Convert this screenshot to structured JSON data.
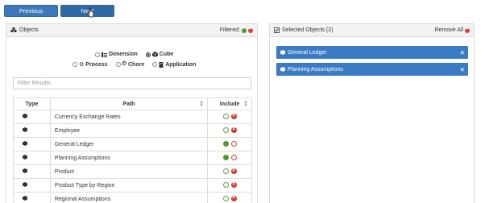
{
  "nav": {
    "previous_label": "Previous",
    "next_label": "Next"
  },
  "left_panel": {
    "title": "Objects",
    "filtered_label": "Filtered:",
    "types_row1": [
      {
        "label": "Dimension",
        "selected": false
      },
      {
        "label": "Cube",
        "selected": true
      }
    ],
    "types_row2": [
      {
        "label": "Process",
        "selected": false
      },
      {
        "label": "Chore",
        "selected": false
      },
      {
        "label": "Application",
        "selected": false
      }
    ],
    "filter_placeholder": "Filter Results",
    "table": {
      "headers": {
        "type": "Type",
        "path": "Path",
        "include": "Include"
      },
      "rows": [
        {
          "path": "Currency Exchange Rates",
          "include": "excluded"
        },
        {
          "path": "Employee",
          "include": "excluded"
        },
        {
          "path": "General Ledger",
          "include": "included"
        },
        {
          "path": "Planning Assumptions",
          "include": "included"
        },
        {
          "path": "Product",
          "include": "excluded"
        },
        {
          "path": "Product Type by Region",
          "include": "excluded"
        },
        {
          "path": "Regional Assumptions",
          "include": "excluded"
        }
      ]
    }
  },
  "right_panel": {
    "title": "Selected Objects (2)",
    "remove_all_label": "Remove All",
    "items": [
      "General Ledger",
      "Planning Assumptions"
    ]
  }
}
